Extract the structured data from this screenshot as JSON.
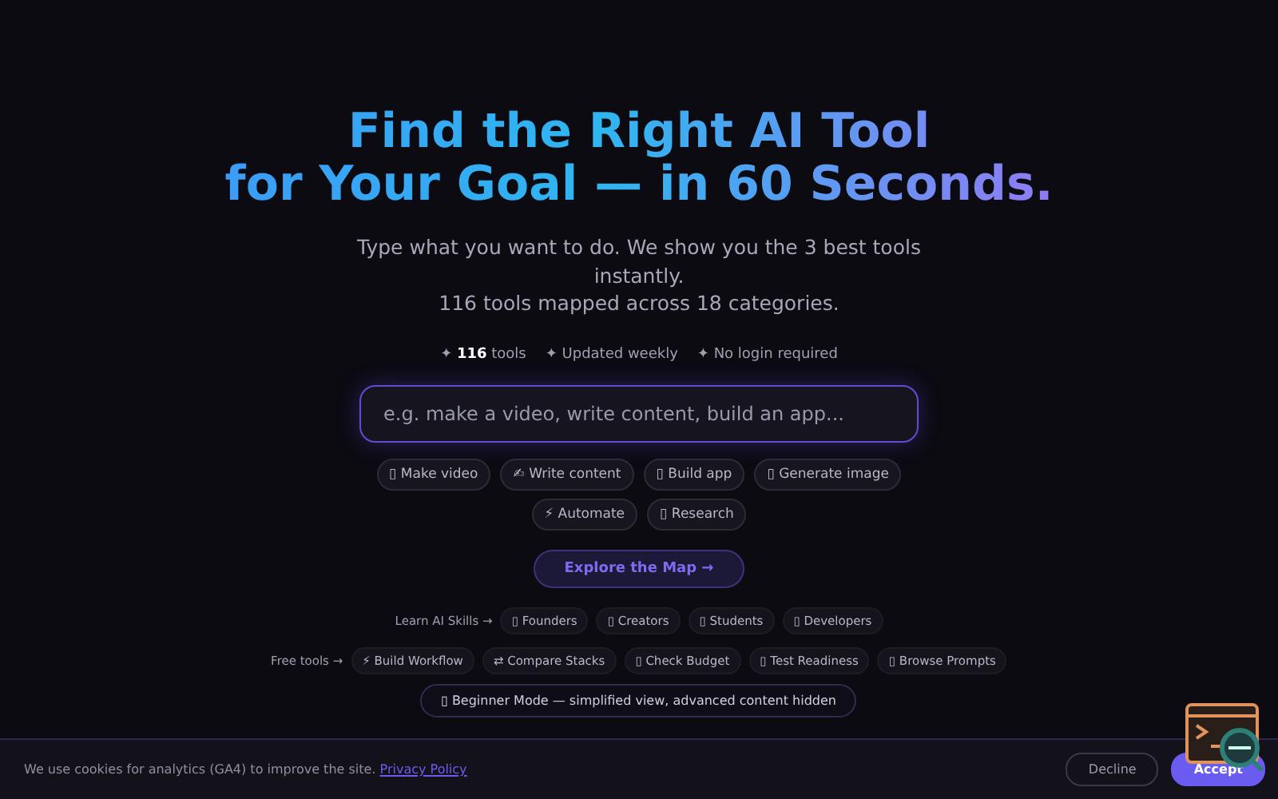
{
  "hero": {
    "title_line_1": "Find the Right AI Tool",
    "title_line_2": "for Your Goal — in 60 Seconds.",
    "subtitle_line_1": "Type what you want to do. We show you the 3 best tools instantly.",
    "subtitle_line_2": "116 tools mapped across 18 categories."
  },
  "stats": [
    {
      "text": "✦ **116** tools"
    },
    {
      "text": "✦ Updated weekly"
    },
    {
      "text": "✦ No login required"
    }
  ],
  "search": {
    "placeholder": "e.g. make a video, write content, build an app..."
  },
  "goal_chips": [
    "▯ Make video",
    "✍ Write content",
    "▯ Build app",
    "▯ Generate image",
    "⚡ Automate",
    "▯ Research"
  ],
  "explore_button": "Explore the Map →",
  "skills": {
    "label": "Learn AI Skills →",
    "items": [
      "▯ Founders",
      "▯ Creators",
      "▯ Students",
      "▯ Developers"
    ]
  },
  "free_tools": {
    "label": "Free tools →",
    "items": [
      "⚡ Build Workflow",
      "⇄ Compare Stacks",
      "▯ Check Budget",
      "▯ Test Readiness",
      "▯ Browse Prompts"
    ]
  },
  "beginner_banner": "▯ Beginner Mode — simplified view, advanced content hidden",
  "cookie_bar": {
    "message": "We use cookies for analytics (GA4) to improve the site.",
    "link": "Privacy Policy",
    "buttons": [
      {
        "label": "Decline",
        "kind": "secondary"
      },
      {
        "label": "Accept",
        "kind": "primary"
      }
    ]
  }
}
